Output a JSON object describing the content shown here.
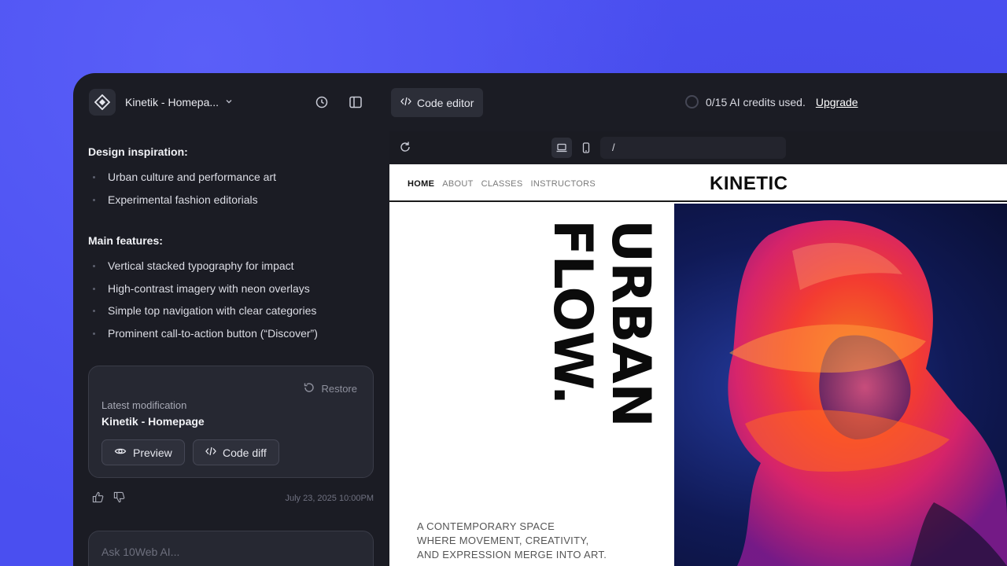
{
  "app": {
    "project_name": "Kinetik - Homepa...",
    "code_editor_label": "Code editor",
    "credits_text": "0/15 AI credits used.",
    "upgrade_label": "Upgrade"
  },
  "chat": {
    "sections": [
      {
        "title": "Design inspiration:",
        "items": [
          "Urban culture and performance art",
          "Experimental fashion editorials"
        ]
      },
      {
        "title": "Main features:",
        "items": [
          "Vertical stacked typography for impact",
          "High-contrast imagery with neon overlays",
          "Simple top navigation with clear categories",
          "Prominent call-to-action button (“Discover”)"
        ]
      }
    ],
    "modification": {
      "restore_label": "Restore",
      "label": "Latest modification",
      "title": "Kinetik - Homepage",
      "preview_label": "Preview",
      "code_diff_label": "Code diff"
    },
    "timestamp": "July 23, 2025 10:00PM",
    "input_placeholder": "Ask 10Web AI..."
  },
  "browser": {
    "url": "/"
  },
  "site": {
    "nav": [
      "HOME",
      "ABOUT",
      "CLASSES",
      "INSTRUCTORS"
    ],
    "brand": "KINETIC",
    "hero_lines": [
      "URBAN",
      "FLOW."
    ],
    "description_lines": [
      "A CONTEMPORARY SPACE",
      "WHERE MOVEMENT, CREATIVITY,",
      "AND EXPRESSION MERGE INTO ART."
    ]
  },
  "icons": {
    "logo": "diamond-logo-icon",
    "history": "history-icon",
    "sidebar_toggle": "sidebar-toggle-icon",
    "refresh": "refresh-icon",
    "desktop": "desktop-icon",
    "mobile": "mobile-icon"
  }
}
